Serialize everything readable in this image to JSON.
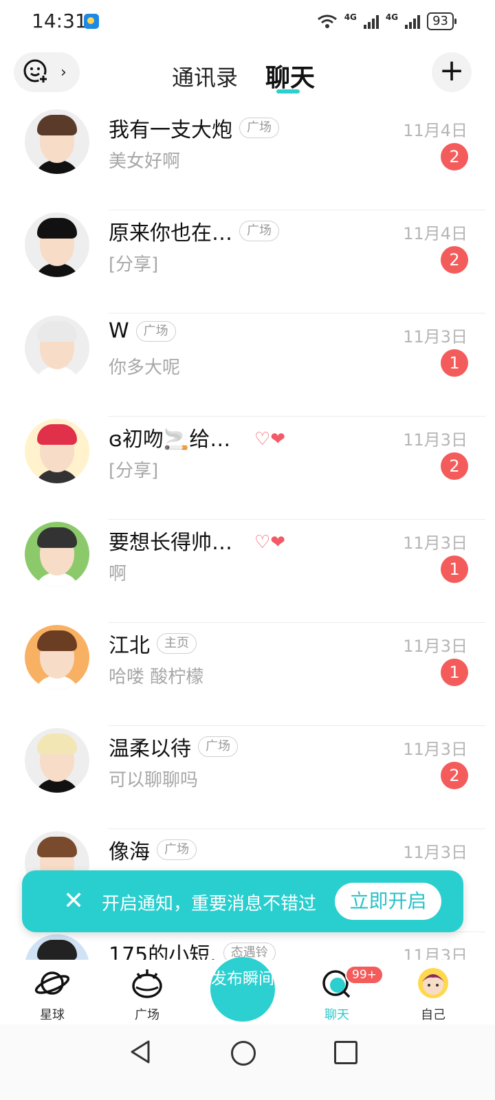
{
  "status_bar": {
    "time": "14:31",
    "network_1": "4G",
    "network_2": "4G",
    "battery": "93"
  },
  "header": {
    "tabs": [
      {
        "label": "通讯录",
        "active": false
      },
      {
        "label": "聊天",
        "active": true
      }
    ],
    "left_icon": "add-friend-face-icon",
    "right_icon": "plus-icon"
  },
  "chats": [
    {
      "name": "我有一支大炮",
      "tag": "广场",
      "message": "美女好啊",
      "date": "11月4日",
      "unread": "2",
      "avatar_bg": "#eeeeee",
      "hair": "#5a3b2a",
      "shirt": "#111111"
    },
    {
      "name": "原来你也在…",
      "tag": "广场",
      "message": "[分享]",
      "date": "11月4日",
      "unread": "2",
      "avatar_bg": "#eeeeee",
      "hair": "#111111",
      "shirt": "#111111"
    },
    {
      "name": "W",
      "tag": "广场",
      "message": "你多大呢",
      "date": "11月3日",
      "unread": "1",
      "avatar_bg": "#eeeeee",
      "hair": "#e9e9e9",
      "shirt": "#ffffff"
    },
    {
      "name": "ɞ初吻🚬给…",
      "tag": "",
      "hearts": "♡❤",
      "message": "[分享]",
      "date": "11月3日",
      "unread": "2",
      "avatar_bg": "#fff2cc",
      "hair": "#e0304a",
      "shirt": "#333333"
    },
    {
      "name": "要想长得帅…",
      "tag": "",
      "hearts": "♡❤",
      "message": "啊",
      "date": "11月3日",
      "unread": "1",
      "avatar_bg": "#8bc96b",
      "hair": "#333333",
      "shirt": "#ffffff"
    },
    {
      "name": "江北",
      "tag": "主页",
      "message": "哈喽 酸柠檬",
      "date": "11月3日",
      "unread": "1",
      "avatar_bg": "#f8b063",
      "hair": "#6b3d22",
      "shirt": "#ffffff"
    },
    {
      "name": "温柔以待",
      "tag": "广场",
      "message": "可以聊聊吗",
      "date": "11月3日",
      "unread": "2",
      "avatar_bg": "#eeeeee",
      "hair": "#f3e6b5",
      "shirt": "#111111"
    },
    {
      "name": "像海",
      "tag": "广场",
      "message": "",
      "date": "11月3日",
      "unread": "",
      "avatar_bg": "#eeeeee",
      "hair": "#7a4a2c",
      "shirt": "#ffffff"
    },
    {
      "name": "175的小短.",
      "tag": "态遇铃",
      "message": "",
      "date": "11月3日",
      "unread": "",
      "avatar_bg": "#cfe3f5",
      "hair": "#222222",
      "shirt": "#ffffff"
    }
  ],
  "toast": {
    "text": "开启通知，重要消息不错过",
    "button": "立即开启"
  },
  "bottom_nav": {
    "items": [
      {
        "label": "星球",
        "icon": "planet-icon"
      },
      {
        "label": "广场",
        "icon": "square-icon"
      },
      {
        "label": "聊天",
        "icon": "chat-icon",
        "badge": "99+"
      },
      {
        "label": "自己",
        "icon": "me-avatar-icon"
      }
    ],
    "publish": "发布瞬间"
  },
  "colors": {
    "accent": "#2ccfcf",
    "badge": "#f45b5b"
  }
}
